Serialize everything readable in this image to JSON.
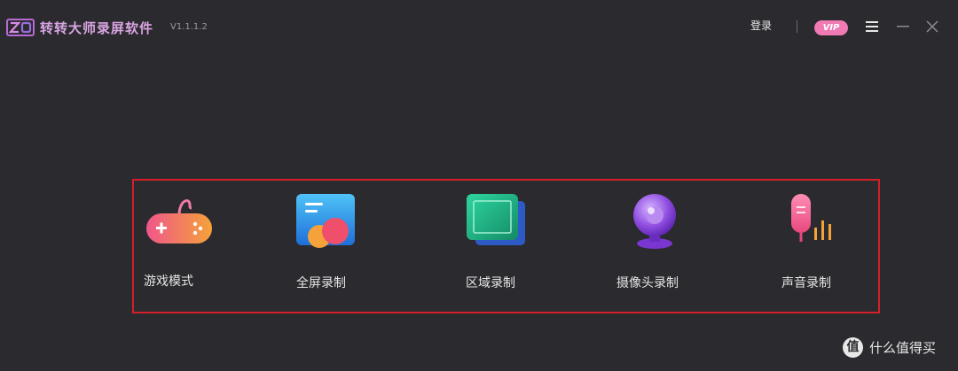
{
  "window": {
    "title": "转转大师录屏软件",
    "version": "V1.1.1.2",
    "login_label": "登录",
    "vip_label": "VIP"
  },
  "modes": [
    {
      "label": "游戏模式",
      "icon": "gamepad-icon"
    },
    {
      "label": "全屏录制",
      "icon": "fullscreen-record-icon"
    },
    {
      "label": "区域录制",
      "icon": "region-record-icon"
    },
    {
      "label": "摄像头录制",
      "icon": "webcam-icon"
    },
    {
      "label": "声音录制",
      "icon": "microphone-icon"
    }
  ],
  "watermark": {
    "badge": "值",
    "text": "什么值得买"
  },
  "colors": {
    "background": "#2b2a2e",
    "highlight_border": "#d41f2a",
    "vip_pill": "#f07ab4",
    "title_text": "#d9a5e3"
  }
}
